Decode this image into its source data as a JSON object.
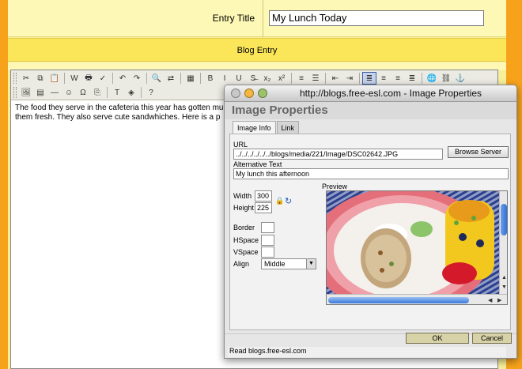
{
  "page": {
    "entry_title_label": "Entry Title",
    "entry_title_value": "My Lunch Today",
    "blog_entry_label": "Blog Entry"
  },
  "editor": {
    "text_line1": "The food they serve in the cafeteria this year has gotten muc",
    "text_line2": "them fresh.  They also serve cute sandwhiches.  Here is a p",
    "toolbar_row1": [
      {
        "name": "cut-icon",
        "glyph": "✂"
      },
      {
        "name": "copy-icon",
        "glyph": "⧉"
      },
      {
        "name": "paste-icon",
        "glyph": "📋"
      },
      {
        "name": "paste-word-icon",
        "glyph": "W"
      },
      {
        "name": "print-icon",
        "glyph": "🖶"
      },
      {
        "name": "spellcheck-icon",
        "glyph": "✓"
      },
      {
        "name": "undo-icon",
        "glyph": "↶"
      },
      {
        "name": "redo-icon",
        "glyph": "↷"
      },
      {
        "name": "find-icon",
        "glyph": "🔍"
      },
      {
        "name": "replace-icon",
        "glyph": "⇄"
      },
      {
        "name": "select-all-icon",
        "glyph": "▦"
      },
      {
        "name": "bold-icon",
        "glyph": "B"
      },
      {
        "name": "italic-icon",
        "glyph": "I"
      },
      {
        "name": "underline-icon",
        "glyph": "U"
      },
      {
        "name": "strikethrough-icon",
        "glyph": "S̶"
      },
      {
        "name": "subscript-icon",
        "glyph": "x₂"
      },
      {
        "name": "superscript-icon",
        "glyph": "x²"
      },
      {
        "name": "ordered-list-icon",
        "glyph": "≡"
      },
      {
        "name": "unordered-list-icon",
        "glyph": "☰"
      },
      {
        "name": "outdent-icon",
        "glyph": "⇤"
      },
      {
        "name": "indent-icon",
        "glyph": "⇥"
      },
      {
        "name": "align-left-icon",
        "glyph": "≣"
      },
      {
        "name": "align-center-icon",
        "glyph": "≡"
      },
      {
        "name": "align-right-icon",
        "glyph": "≡"
      },
      {
        "name": "justify-icon",
        "glyph": "≣"
      },
      {
        "name": "link-icon",
        "glyph": "🌐"
      },
      {
        "name": "unlink-icon",
        "glyph": "⛓"
      },
      {
        "name": "anchor-icon",
        "glyph": "⚓"
      }
    ],
    "toolbar_row2": [
      {
        "name": "image-icon",
        "glyph": "🖼"
      },
      {
        "name": "table-icon",
        "glyph": "▤"
      },
      {
        "name": "horizontal-rule-icon",
        "glyph": "—"
      },
      {
        "name": "smiley-icon",
        "glyph": "☺"
      },
      {
        "name": "special-char-icon",
        "glyph": "Ω"
      },
      {
        "name": "page-break-icon",
        "glyph": "⎘"
      },
      {
        "name": "text-color-icon",
        "glyph": "T"
      },
      {
        "name": "background-color-icon",
        "glyph": "◈"
      },
      {
        "name": "about-icon",
        "glyph": "?"
      }
    ]
  },
  "dialog": {
    "window_title": "http://blogs.free-esl.com - Image Properties",
    "heading": "Image Properties",
    "tabs": [
      "Image Info",
      "Link"
    ],
    "url_label": "URL",
    "url_value": "../../../../../../blogs/media/221/Image/DSC02642.JPG",
    "browse_button": "Browse Server",
    "alt_label": "Alternative Text",
    "alt_value": "My lunch this afternoon",
    "width_label": "Width",
    "width_value": "300",
    "height_label": "Height",
    "height_value": "225",
    "preview_label": "Preview",
    "border_label": "Border",
    "hspace_label": "HSpace",
    "vspace_label": "VSpace",
    "align_label": "Align",
    "align_value": "Middle",
    "ok_button": "OK",
    "cancel_button": "Cancel",
    "status_text": "Read blogs.free-esl.com"
  }
}
